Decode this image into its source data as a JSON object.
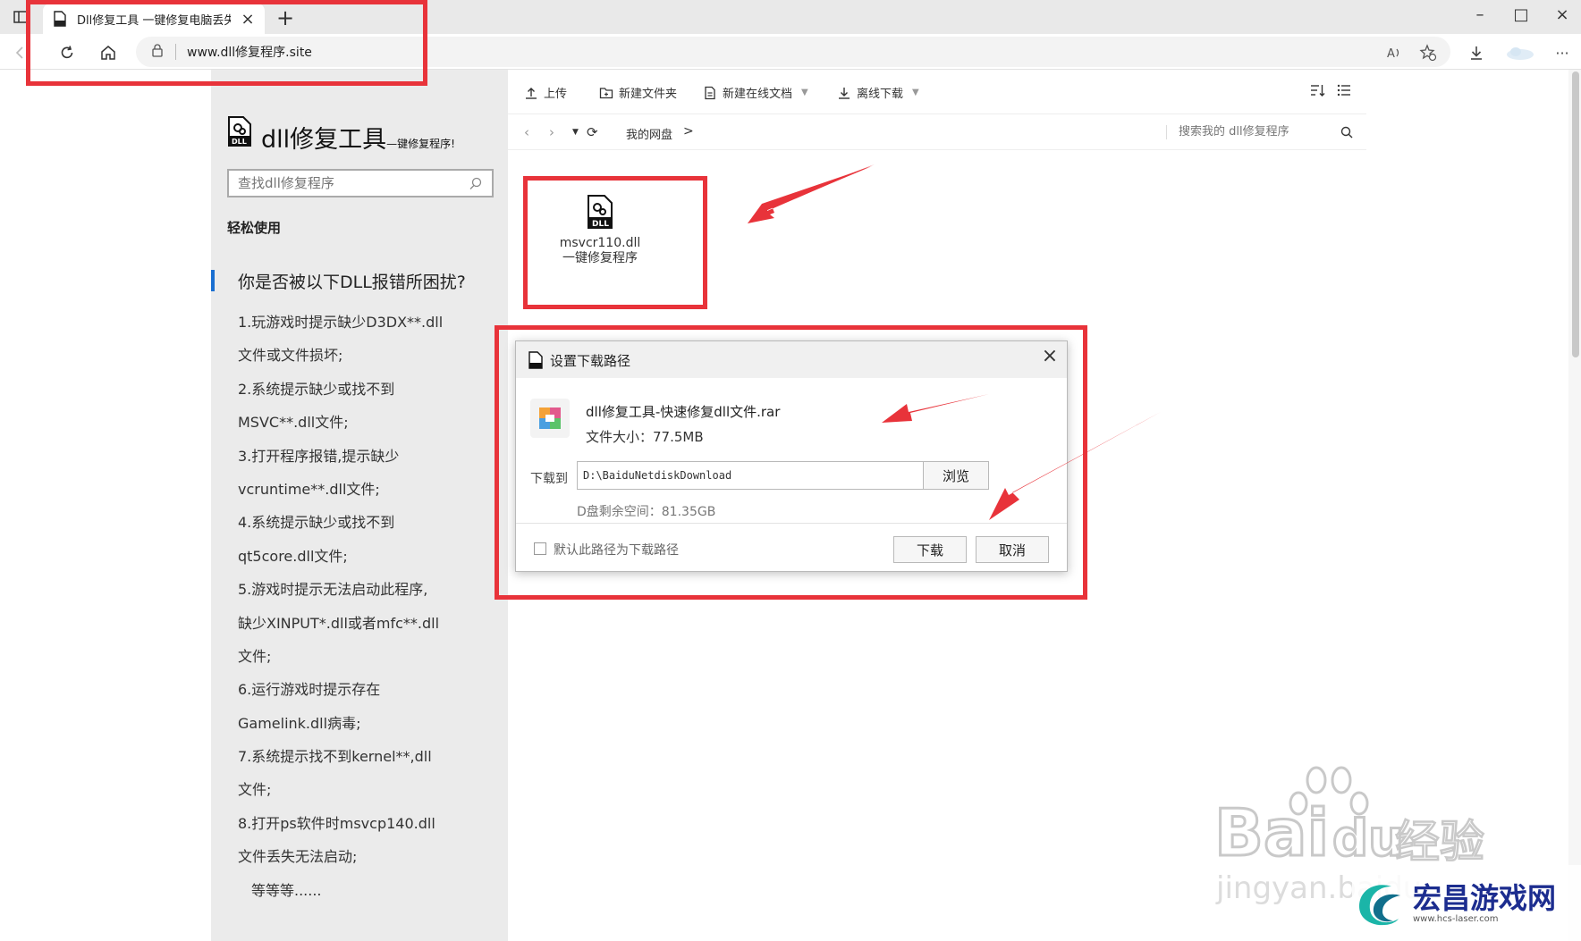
{
  "browser": {
    "tab_title": "Dll修复工具 一键修复电脑丢失Dll",
    "url": "www.dll修复程序.site"
  },
  "sidebar": {
    "site_title": "dll修复工具",
    "site_subtitle": "—键修复程序!",
    "search_placeholder": "查找dll修复程序",
    "easy_use": "轻松使用",
    "question": "你是否被以下DLL报错所困扰?",
    "items": [
      "1.玩游戏时提示缺少D3DX**.dll",
      "文件或文件损坏;",
      "2.系统提示缺少或找不到",
      "MSVC**.dll文件;",
      "3.打开程序报错,提示缺少",
      "vcruntime**.dll文件;",
      "4.系统提示缺少或找不到",
      "qt5core.dll文件;",
      "5.游戏时提示无法启动此程序,",
      "缺少XINPUT*.dll或者mfc**.dll",
      "文件;",
      "6.运行游戏时提示存在",
      "Gamelink.dll病毒;",
      "7.系统提示找不到kernel**,dll",
      "文件;",
      "8.打开ps软件时msvcp140.dll",
      "文件丢失无法启动;"
    ],
    "etc": "等等等......"
  },
  "disk": {
    "actions": {
      "upload": "上传",
      "new_folder": "新建文件夹",
      "new_doc": "新建在线文档",
      "offline_download": "离线下载"
    },
    "breadcrumb": "我的网盘",
    "breadcrumb_sep": ">",
    "search_placeholder": "搜索我的 dll修复程序",
    "file": {
      "name_line1": "msvcr110.dll",
      "name_line2": "一键修复程序"
    }
  },
  "dialog": {
    "title": "设置下载路径",
    "file_name": "dll修复工具-快速修复dll文件.rar",
    "file_size": "文件大小：77.5MB",
    "download_to_label": "下载到",
    "path": "D:\\BaiduNetdiskDownload",
    "browse": "浏览",
    "free_space": "D盘剩余空间：81.35GB",
    "default_path_label": "默认此路径为下载路径",
    "download": "下载",
    "cancel": "取消"
  },
  "watermark": {
    "baidu_line1": "Bai",
    "baidu_du": "du",
    "baidu_jingyan": "经验",
    "baidu_line2": "jingyan.baidu",
    "site_name": "宏昌游戏网",
    "site_url": "www.hcs-laser.com"
  },
  "colors": {
    "annotation_red": "#e8333a",
    "accent_blue": "#1a6fd1",
    "sidebar_bg": "#ebebeb"
  }
}
